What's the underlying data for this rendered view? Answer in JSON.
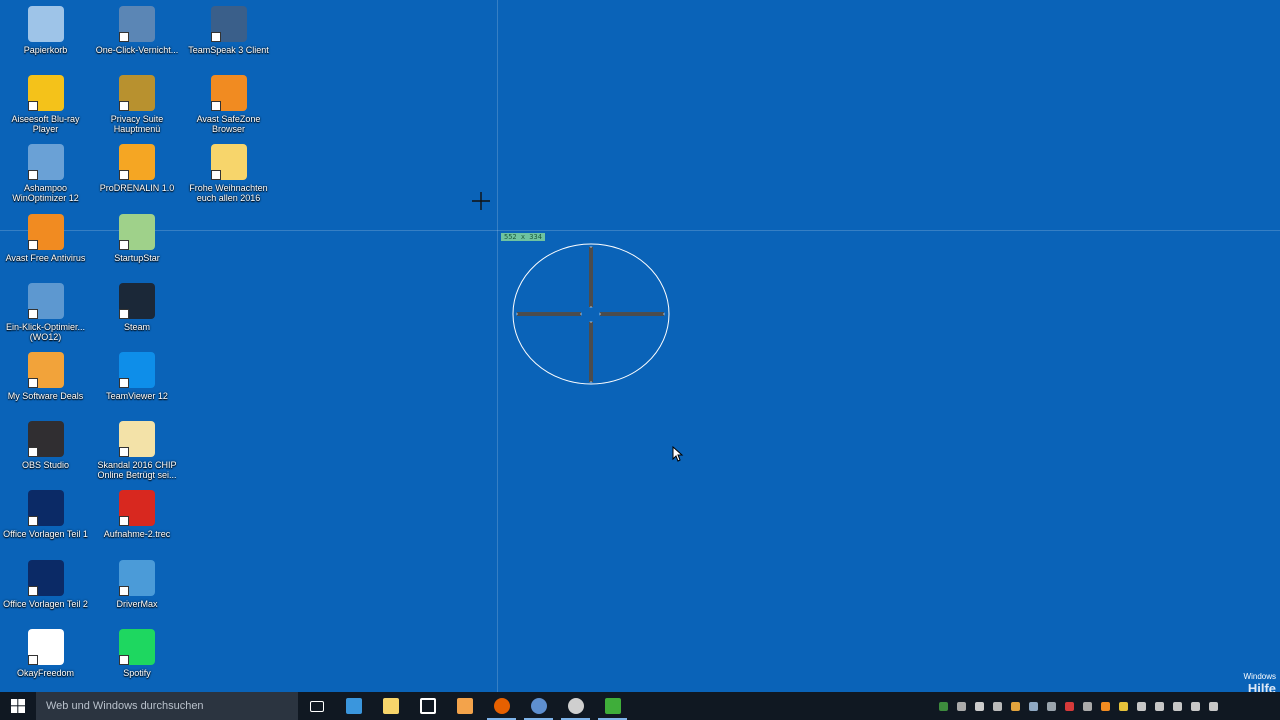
{
  "desktop_icons": [
    {
      "label": "Papierkorb",
      "icon": "recycle-bin-icon",
      "color": "#9ec4e8"
    },
    {
      "label": "One-Click-Vernicht...",
      "icon": "shredder-icon",
      "color": "#5b86b5"
    },
    {
      "label": "TeamSpeak 3 Client",
      "icon": "teamspeak-icon",
      "color": "#3a5f8a"
    },
    {
      "label": "Aiseesoft Blu-ray Player",
      "icon": "bluray-player-icon",
      "color": "#f4c21a"
    },
    {
      "label": "Privacy Suite Hauptmenü",
      "icon": "privacy-lock-icon",
      "color": "#b8912f"
    },
    {
      "label": "Avast SafeZone Browser",
      "icon": "avast-safezone-icon",
      "color": "#f18b21"
    },
    {
      "label": "Ashampoo WinOptimizer 12",
      "icon": "winoptimizer-icon",
      "color": "#6aa1d6"
    },
    {
      "label": "ProDRENALIN 1.0",
      "icon": "prodrenalin-icon",
      "color": "#f5a623"
    },
    {
      "label": "Frohe Weihnachten euch allen 2016",
      "icon": "folder-icon",
      "color": "#f7d56b"
    },
    {
      "label": "Avast Free Antivirus",
      "icon": "avast-antivirus-icon",
      "color": "#f18b21"
    },
    {
      "label": "StartupStar",
      "icon": "startupstar-icon",
      "color": "#9fd18a"
    },
    {
      "label": "Ein-Klick-Optimier... (WO12)",
      "icon": "one-click-optimizer-icon",
      "color": "#5d98d0"
    },
    {
      "label": "Steam",
      "icon": "steam-icon",
      "color": "#1b2838"
    },
    {
      "label": "My Software Deals",
      "icon": "shopping-cart-icon",
      "color": "#f2a33a"
    },
    {
      "label": "TeamViewer 12",
      "icon": "teamviewer-icon",
      "color": "#0e8ee9"
    },
    {
      "label": "OBS Studio",
      "icon": "obs-icon",
      "color": "#302e31"
    },
    {
      "label": "Skandal 2016 CHIP Online Betrügt sei...",
      "icon": "document-icon",
      "color": "#f3e2a8"
    },
    {
      "label": "Office Vorlagen Teil 1",
      "icon": "franzis-icon",
      "color": "#0b2a66"
    },
    {
      "label": "Aufnahme-2.trec",
      "icon": "camtasia-recording-icon",
      "color": "#d8281f"
    },
    {
      "label": "Office Vorlagen Teil 2",
      "icon": "franzis-icon",
      "color": "#0b2a66"
    },
    {
      "label": "DriverMax",
      "icon": "drivermax-icon",
      "color": "#4b9bd8"
    },
    {
      "label": "OkayFreedom",
      "icon": "okayfreedom-icon",
      "color": "#ffffff"
    },
    {
      "label": "Spotify",
      "icon": "spotify-icon",
      "color": "#1ed760"
    }
  ],
  "overlay": {
    "coordinate_readout": "552 x 334"
  },
  "taskbar": {
    "search_placeholder": "Web und Windows durchsuchen",
    "pinned": [
      {
        "name": "task-view",
        "icon": "task-view-icon",
        "color": "#ffffff"
      },
      {
        "name": "edge",
        "icon": "edge-icon",
        "color": "#3a96dd"
      },
      {
        "name": "file-explorer",
        "icon": "folder-icon",
        "color": "#f7d56b"
      },
      {
        "name": "store",
        "icon": "store-icon",
        "color": "#ffffff"
      },
      {
        "name": "media-player",
        "icon": "media-player-icon",
        "color": "#f3a34b"
      },
      {
        "name": "firefox",
        "icon": "firefox-icon",
        "color": "#e66000"
      },
      {
        "name": "thunderbird",
        "icon": "thunderbird-icon",
        "color": "#5e8fcf"
      },
      {
        "name": "obs",
        "icon": "obs-icon",
        "color": "#cfcfcf"
      },
      {
        "name": "camtasia",
        "icon": "camtasia-icon",
        "color": "#3fae3a"
      }
    ],
    "tray": [
      {
        "icon": "tray-app-icon",
        "color": "#3d8b3d"
      },
      {
        "icon": "tray-settings-icon",
        "color": "#aaaaaa"
      },
      {
        "icon": "tray-dot-icon",
        "color": "#cccccc"
      },
      {
        "icon": "tray-pen-icon",
        "color": "#bbbbbb"
      },
      {
        "icon": "tray-colorful-icon",
        "color": "#e2a33d"
      },
      {
        "icon": "tray-steam-icon",
        "color": "#8ea8c3"
      },
      {
        "icon": "tray-network-icon",
        "color": "#9aa4ad"
      },
      {
        "icon": "tray-red-icon",
        "color": "#d63a3a"
      },
      {
        "icon": "tray-ring-icon",
        "color": "#aaaaaa"
      },
      {
        "icon": "tray-avast-icon",
        "color": "#f18b21"
      },
      {
        "icon": "tray-flag-icon",
        "color": "#e6c23a"
      },
      {
        "icon": "tray-cloud-icon",
        "color": "#c7c7c7"
      },
      {
        "icon": "tray-up-icon",
        "color": "#c7c7c7"
      },
      {
        "icon": "tray-monitor-icon",
        "color": "#c7c7c7"
      },
      {
        "icon": "volume-icon",
        "color": "#c7c7c7"
      },
      {
        "icon": "notifications-icon",
        "color": "#c7c7c7"
      }
    ]
  },
  "watermark": {
    "line1": "Windows",
    "line2": "Hilfe"
  }
}
